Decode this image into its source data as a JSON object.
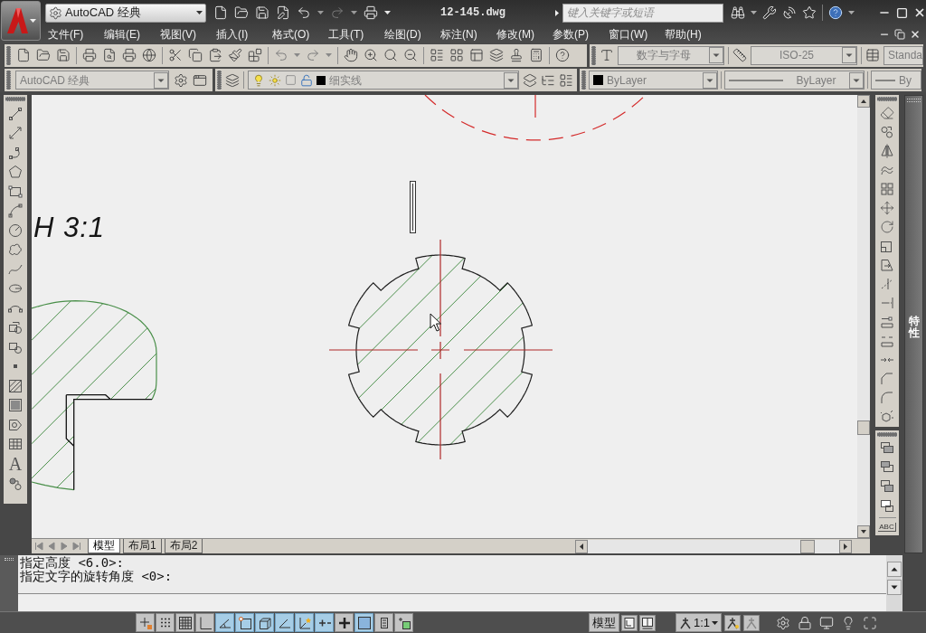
{
  "title_bar": {
    "workspace": "AutoCAD 经典",
    "quick_access": {
      "undo_disabled": false,
      "redo_disabled": true
    },
    "title": "12-145.dwg",
    "search": {
      "placeholder": "键入关键字或短语"
    }
  },
  "menu_bar": [
    "文件(F)",
    "编辑(E)",
    "视图(V)",
    "插入(I)",
    "格式(O)",
    "工具(T)",
    "绘图(D)",
    "标注(N)",
    "修改(M)",
    "参数(P)",
    "窗口(W)",
    "帮助(H)"
  ],
  "styles_toolbar": {
    "disabled": true,
    "text_style": "数字与字母",
    "dimension_style": "ISO-25",
    "table_style": "Standa"
  },
  "workspaces_toolbar": {
    "disabled": true,
    "workspace": "AutoCAD 经典"
  },
  "layers_toolbar": {
    "disabled": true,
    "layer": "细实线"
  },
  "properties_toolbar": {
    "disabled": true,
    "colour_setting": "ByLayer",
    "linetype": "ByLayer",
    "lineweight": "By"
  },
  "draw_toolbar": {
    "text_tool": "A"
  },
  "drawing": {
    "label": "H 3:1"
  },
  "layout_tabs": [
    {
      "label": "模型",
      "selected": true
    },
    {
      "label": "布局1",
      "selected": false
    },
    {
      "label": "布局2",
      "selected": false
    }
  ],
  "draw_order_toolbar": {
    "text_tool": "ABC"
  },
  "properties_palette": {
    "title": "特性"
  },
  "command_line": {
    "history": [
      "指定高度 <6.0>:",
      "指定文字的旋转角度 <0>:"
    ]
  },
  "status_bar": {
    "drafting_toggles": [
      {
        "on": false
      },
      {
        "on": false
      },
      {
        "on": false
      },
      {
        "on": false
      },
      {
        "on": true
      },
      {
        "on": true
      },
      {
        "on": true
      },
      {
        "on": true
      },
      {
        "on": true
      },
      {
        "on": true
      },
      {
        "on": false
      },
      {
        "on": true
      },
      {
        "on": false
      },
      {
        "on": false
      }
    ],
    "space": "模型",
    "annotation_scale": "1:1"
  }
}
